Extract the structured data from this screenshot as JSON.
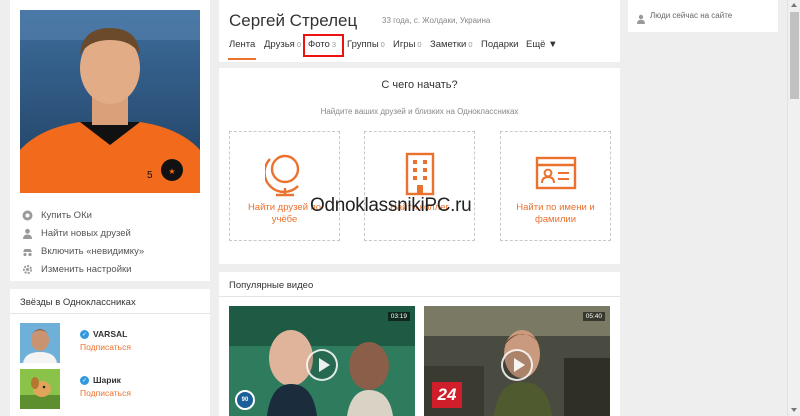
{
  "left": {
    "menu": [
      {
        "label": "Купить ОКи",
        "icon": "ok-coin-icon"
      },
      {
        "label": "Найти новых друзей",
        "icon": "person-icon"
      },
      {
        "label": "Включить «невидимку»",
        "icon": "invisible-icon"
      },
      {
        "label": "Изменить настройки",
        "icon": "gear-icon"
      }
    ]
  },
  "stars": {
    "title": "Звёзды в Одноклассниках",
    "items": [
      {
        "name": "VARSAL",
        "action": "Подписаться"
      },
      {
        "name": "Шарик",
        "action": "Подписаться"
      }
    ]
  },
  "profile": {
    "name": "Сергей Стрелец",
    "info": "33 года, с. Жолдаки, Украина",
    "tabs": [
      {
        "label": "Лента",
        "count": ""
      },
      {
        "label": "Друзья",
        "count": "0"
      },
      {
        "label": "Фото",
        "count": "3"
      },
      {
        "label": "Группы",
        "count": "0"
      },
      {
        "label": "Игры",
        "count": "0"
      },
      {
        "label": "Заметки",
        "count": "0"
      },
      {
        "label": "Подарки",
        "count": ""
      },
      {
        "label": "Ещё ▼",
        "count": ""
      }
    ]
  },
  "start": {
    "title": "С чего начать?",
    "subtitle": "Найдите ваших друзей и близких на Одноклассниках",
    "tiles": [
      {
        "label": "Найти друзей по учёбе",
        "icon": "globe-icon"
      },
      {
        "label": "Найти коллег",
        "icon": "building-icon"
      },
      {
        "label": "Найти по имени и фамилии",
        "icon": "id-card-icon"
      }
    ]
  },
  "watermark": "OdnoklassnikiPC.ru",
  "videos": {
    "title": "Популярные видео",
    "items": [
      {
        "duration": "03:19",
        "channel_badge": "90"
      },
      {
        "duration": "05:40",
        "channel_badge": "24"
      }
    ]
  },
  "right": {
    "online_label": "Люди сейчас на сайте"
  },
  "colors": {
    "accent": "#eb722e",
    "highlight": "#ee1111",
    "verified": "#3399dd"
  }
}
